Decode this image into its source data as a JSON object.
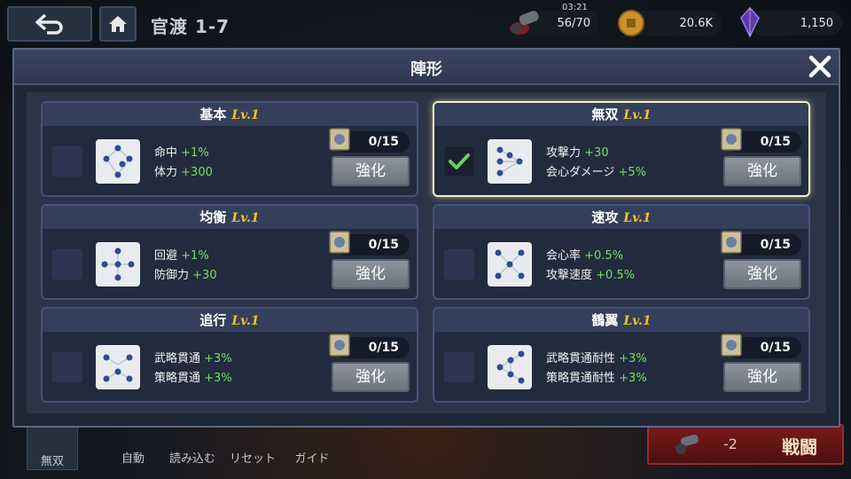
{
  "header": {
    "stage_title": "官渡 1-7",
    "stamina_timer": "03:21",
    "stamina": "56/70",
    "gold": "20.6K",
    "gems": "1,150"
  },
  "modal": {
    "title": "陣形",
    "formations": [
      {
        "name": "基本",
        "level": "Lv.1",
        "selected": false,
        "stats": [
          {
            "label": "命中",
            "value": "+1%"
          },
          {
            "label": "体力",
            "value": "+300"
          }
        ],
        "count": "0/15",
        "enhance_label": "強化",
        "icon": "basic-formation-icon"
      },
      {
        "name": "無双",
        "level": "Lv.1",
        "selected": true,
        "stats": [
          {
            "label": "攻撃力",
            "value": "+30"
          },
          {
            "label": "会心ダメージ",
            "value": "+5%"
          }
        ],
        "count": "0/15",
        "enhance_label": "強化",
        "icon": "musou-formation-icon"
      },
      {
        "name": "均衡",
        "level": "Lv.1",
        "selected": false,
        "stats": [
          {
            "label": "回避",
            "value": "+1%"
          },
          {
            "label": "防御力",
            "value": "+30"
          }
        ],
        "count": "0/15",
        "enhance_label": "強化",
        "icon": "balance-formation-icon"
      },
      {
        "name": "速攻",
        "level": "Lv.1",
        "selected": false,
        "stats": [
          {
            "label": "会心率",
            "value": "+0.5%"
          },
          {
            "label": "攻撃速度",
            "value": "+0.5%"
          }
        ],
        "count": "0/15",
        "enhance_label": "強化",
        "icon": "rush-formation-icon"
      },
      {
        "name": "追行",
        "level": "Lv.1",
        "selected": false,
        "stats": [
          {
            "label": "武略貫通",
            "value": "+3%"
          },
          {
            "label": "策略貫通",
            "value": "+3%"
          }
        ],
        "count": "0/15",
        "enhance_label": "強化",
        "icon": "pursuit-formation-icon"
      },
      {
        "name": "鶴翼",
        "level": "Lv.1",
        "selected": false,
        "stats": [
          {
            "label": "武略貫通耐性",
            "value": "+3%"
          },
          {
            "label": "策略貫通耐性",
            "value": "+3%"
          }
        ],
        "count": "0/15",
        "enhance_label": "強化",
        "icon": "crane-wing-formation-icon"
      }
    ]
  },
  "bottom": {
    "formation_label": "無双",
    "auto_label": "自動",
    "load_label": "読み込む",
    "reset_label": "リセット",
    "guide_label": "ガイド",
    "battle_cost": "-2",
    "battle_label": "戦闘"
  },
  "colors": {
    "stat_bonus": "#73e05a",
    "level": "#f1c22c",
    "selected_border": "#f4f0c2"
  }
}
